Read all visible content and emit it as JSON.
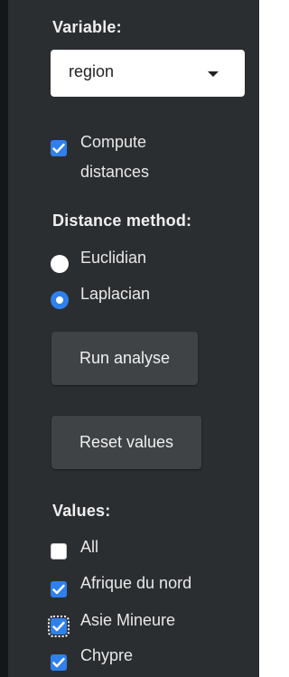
{
  "variable": {
    "label": "Variable:",
    "selected": "region"
  },
  "compute_distances": {
    "line1": "Compute",
    "line2": "distances",
    "checked": true
  },
  "distance_method": {
    "label": "Distance method:",
    "options": [
      {
        "label": "Euclidian",
        "selected": false
      },
      {
        "label": "Laplacian",
        "selected": true
      }
    ]
  },
  "buttons": {
    "run": "Run analyse",
    "reset": "Reset values"
  },
  "values": {
    "label": "Values:",
    "items": [
      {
        "label": "All",
        "checked": false
      },
      {
        "label": "Afrique du nord",
        "checked": true
      },
      {
        "label": "Asie Mineure",
        "checked": true
      },
      {
        "label": "Chypre",
        "checked": true
      }
    ]
  },
  "colors": {
    "panel_bg": "#2b2e31",
    "accent": "#2f80ed",
    "button_bg": "#3f4346"
  }
}
